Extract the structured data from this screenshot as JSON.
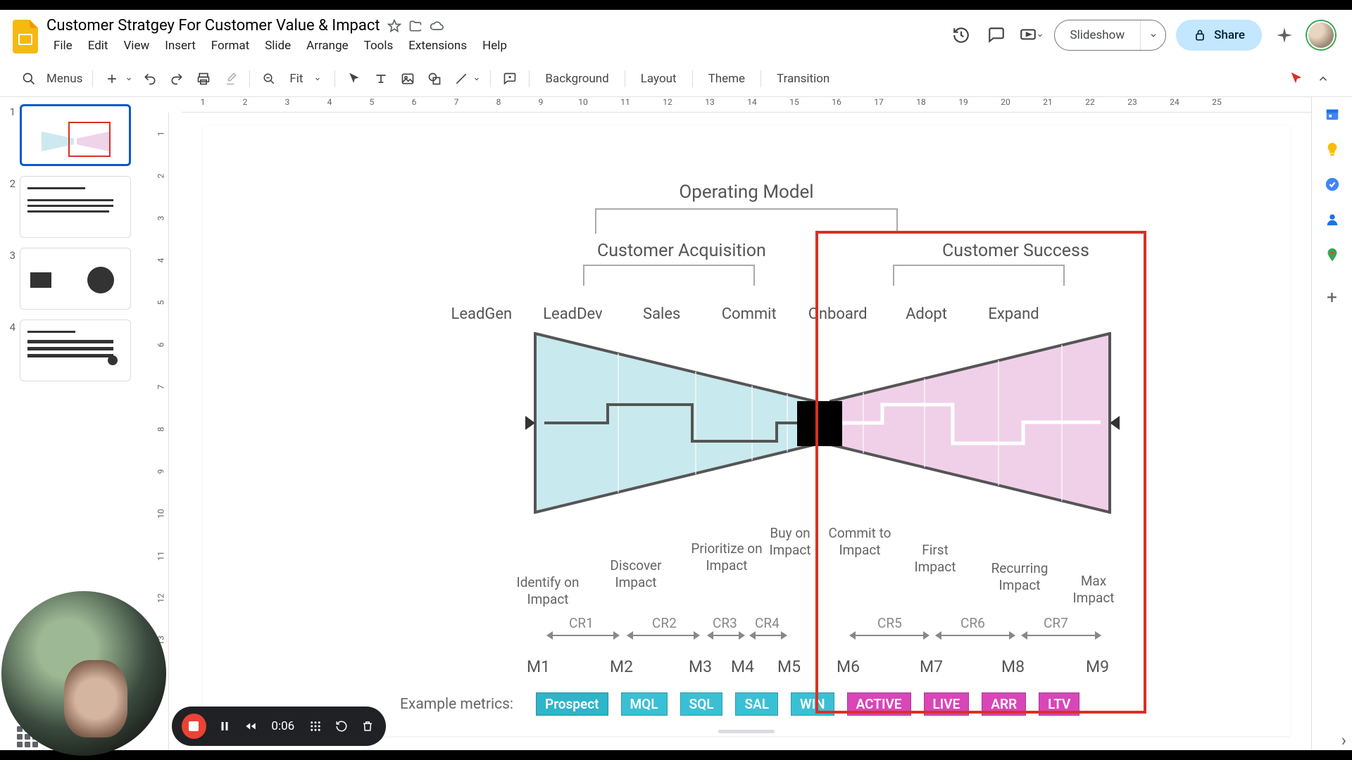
{
  "doc": {
    "title": "Customer Stratgey For Customer Value & Impact"
  },
  "menus": [
    "File",
    "Edit",
    "View",
    "Insert",
    "Format",
    "Slide",
    "Arrange",
    "Tools",
    "Extensions",
    "Help"
  ],
  "toolbar": {
    "search_label": "Menus",
    "zoom": "Fit",
    "labels": {
      "background": "Background",
      "layout": "Layout",
      "theme": "Theme",
      "transition": "Transition"
    }
  },
  "right_actions": {
    "slideshow": "Slideshow",
    "share": "Share"
  },
  "ruler_h": [
    "1",
    "2",
    "3",
    "4",
    "5",
    "6",
    "7",
    "8",
    "9",
    "10",
    "11",
    "12",
    "13",
    "14",
    "15",
    "16",
    "17",
    "18",
    "19",
    "20",
    "21",
    "22",
    "23",
    "24",
    "25"
  ],
  "ruler_v": [
    "1",
    "2",
    "3",
    "4",
    "5",
    "6",
    "7",
    "8",
    "9",
    "10",
    "11",
    "12",
    "13"
  ],
  "slides": {
    "numbers": [
      "1",
      "2",
      "3",
      "4"
    ]
  },
  "content": {
    "title": "Operating Model",
    "phases": {
      "acquisition": "Customer Acquisition",
      "success": "Customer Success"
    },
    "stages": [
      "LeadGen",
      "LeadDev",
      "Sales",
      "Commit",
      "Onboard",
      "Adopt",
      "Expand"
    ],
    "impacts": {
      "identify": "Identify on Impact",
      "discover": "Discover Impact",
      "prioritize": "Prioritize on Impact",
      "buy": "Buy on Impact",
      "commit": "Commit to Impact",
      "first": "First Impact",
      "recurring": "Recurring Impact",
      "max": "Max Impact"
    },
    "cr": [
      "CR1",
      "CR2",
      "CR3",
      "CR4",
      "CR5",
      "CR6",
      "CR7"
    ],
    "m": [
      "M1",
      "M2",
      "M3",
      "M4",
      "M5",
      "M6",
      "M7",
      "M8",
      "M9"
    ],
    "metrics_label": "Example metrics:",
    "metrics": [
      "Prospect",
      "MQL",
      "SQL",
      "SAL",
      "WIN",
      "ACTIVE",
      "LIVE",
      "ARR",
      "LTV"
    ]
  },
  "recorder": {
    "time": "0:06"
  }
}
